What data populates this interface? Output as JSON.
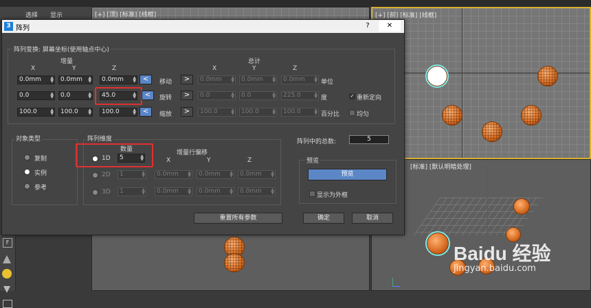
{
  "app": {
    "menu": {
      "select": "选择",
      "display": "显示"
    },
    "viewport_top": {
      "label": "[+] [顶] [标准] [线框]"
    },
    "viewport_right": {
      "label": "[+] [前] [标准] [线框]"
    },
    "viewport_persp": {
      "label": "[标准] [默认明暗处理]"
    }
  },
  "dialog": {
    "title": "阵列",
    "logo": "3",
    "help": "?",
    "close": "✕",
    "transform": {
      "header": "阵列变换: 屏幕坐标(使用轴点中心)",
      "incr_label": "增量",
      "total_label": "总计",
      "axes": [
        "X",
        "Y",
        "Z"
      ],
      "rows": [
        {
          "op": "移动",
          "unit": "单位",
          "inc": [
            "0.0mm",
            "0.0mm",
            "0.0mm"
          ],
          "tot": [
            "0.0mm",
            "0.0mm",
            "0.0mm"
          ]
        },
        {
          "op": "旋转",
          "unit": "度",
          "inc": [
            "0.0",
            "0.0",
            "45.0"
          ],
          "tot": [
            "0.0",
            "0.0",
            "225.0"
          ]
        },
        {
          "op": "缩放",
          "unit": "百分比",
          "inc": [
            "100.0",
            "100.0",
            "100.0"
          ],
          "tot": [
            "100.0",
            "100.0",
            "100.0"
          ]
        }
      ],
      "left_arrow": "<",
      "right_arrow": ">",
      "reorient": "重新定向",
      "uniform": "均匀"
    },
    "object_type": {
      "header": "对象类型",
      "options": [
        "复制",
        "实例",
        "参考"
      ],
      "selected": "实例"
    },
    "dimensions": {
      "header": "阵列维度",
      "count_label": "数量",
      "offset_label": "增量行偏移",
      "axes": [
        "X",
        "Y",
        "Z"
      ],
      "rows": [
        {
          "name": "1D",
          "count": "5",
          "offsets": []
        },
        {
          "name": "2D",
          "count": "1",
          "offsets": [
            "0.0mm",
            "0.0mm",
            "0.0mm"
          ]
        },
        {
          "name": "3D",
          "count": "1",
          "offsets": [
            "0.0mm",
            "0.0mm",
            "0.0mm"
          ]
        }
      ]
    },
    "total": {
      "label": "阵列中的总数:",
      "value": "5"
    },
    "preview": {
      "header": "预览",
      "button": "预览",
      "show_box": "显示为外框"
    },
    "buttons": {
      "reset": "重置所有参数",
      "ok": "确定",
      "cancel": "取消"
    }
  },
  "watermark": {
    "brand": "Baidu 经验",
    "url": "jingyan.baidu.com"
  }
}
